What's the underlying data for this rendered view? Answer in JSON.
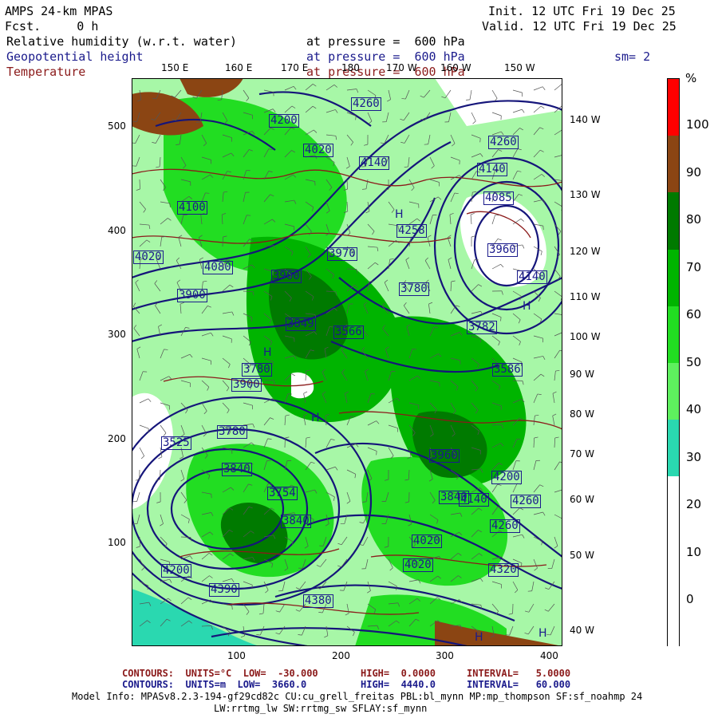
{
  "header": {
    "model": "AMPS 24-km MPAS",
    "fcst": "Fcst.     0 h",
    "init": "Init. 12 UTC Fri 19 Dec 25",
    "valid": "Valid. 12 UTC Fri 19 Dec 25",
    "field1": "Relative humidity (w.r.t. water)",
    "field2": "Geopotential height",
    "field3": "Temperature",
    "level1": "at pressure =  600 hPa",
    "level2": "at pressure =  600 hPa",
    "level3": "at pressure =  600 hPa",
    "smooth": "sm= 2"
  },
  "colors": {
    "rh_scale": [
      "#ffffff",
      "#ffffff",
      "#ffffff",
      "#2ad8b0",
      "#5ef05e",
      "#22dd22",
      "#00b400",
      "#007a00",
      "#8b4513",
      "#ff0000"
    ],
    "height_contour": "#15157a",
    "temp_contour": "#8b1a1a"
  },
  "axes": {
    "top_lon": [
      "150 E",
      "160 E",
      "170 E",
      "180",
      "170 W",
      "160 W",
      "150 W"
    ],
    "right_lon": [
      "140 W",
      "130 W",
      "120 W",
      "110 W",
      "100 W",
      "90 W",
      "80 W",
      "70 W",
      "60 W",
      "50 W",
      "40 W"
    ],
    "left_y": [
      "500",
      "400",
      "300",
      "200",
      "100"
    ],
    "bottom_x": [
      "100",
      "200",
      "300",
      "400"
    ]
  },
  "colorbar": {
    "unit": "%",
    "labels": [
      "100",
      "90",
      "80",
      "70",
      "60",
      "50",
      "40",
      "30",
      "20",
      "10",
      "0"
    ]
  },
  "map_labels": {
    "heights": [
      "4260",
      "4200",
      "4020",
      "4140",
      "4260",
      "4140",
      "4085",
      "4100",
      "4020",
      "3970",
      "4258",
      "3960",
      "4140",
      "4080",
      "3900",
      "3900",
      "3780",
      "3849",
      "3566",
      "3780",
      "3900",
      "3782",
      "3586",
      "3525",
      "3780",
      "3840",
      "3754",
      "3840",
      "3960",
      "3840",
      "4020",
      "4140",
      "4020",
      "4200",
      "4260",
      "4260",
      "4200",
      "4320",
      "4390",
      "4380"
    ]
  },
  "footer": {
    "line1_a": "CONTOURS:  UNITS=°C  LOW=  -30.000",
    "line1_b": "HIGH=  0.0000",
    "line1_c": "INTERVAL=   5.0000",
    "line2_a": "CONTOURS:  UNITS=m  LOW=  3660.0",
    "line2_b": "HIGH=  4440.0",
    "line2_c": "INTERVAL=   60.000",
    "info1": "Model Info: MPASv8.2.3-194-gf29cd82c CU:cu_grell_freitas PBL:bl_mynn MP:mp_thompson SF:sf_noahmp 24",
    "info2": "LW:rrtmg_lw SW:rrtmg_sw SFLAY:sf_mynn"
  }
}
